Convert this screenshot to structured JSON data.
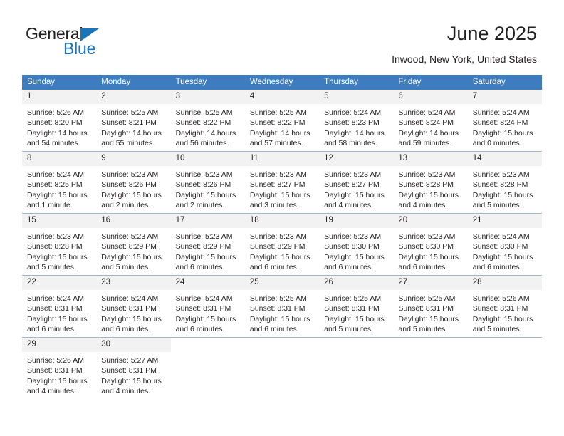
{
  "brand": {
    "line1": "General",
    "line2": "Blue",
    "triangle_color": "#1b75bb",
    "logo_icon": "triangle-icon"
  },
  "header": {
    "month_title": "June 2025",
    "location": "Inwood, New York, United States"
  },
  "theme": {
    "header_blue": "#3d7cbf",
    "daynum_band": "#f2f2f2",
    "week_divider": "#9fb6cd",
    "text": "#231f20"
  },
  "calendar": {
    "weekday_headers": [
      "Sunday",
      "Monday",
      "Tuesday",
      "Wednesday",
      "Thursday",
      "Friday",
      "Saturday"
    ],
    "weeks": [
      [
        {
          "day": "1",
          "sunrise": "Sunrise: 5:26 AM",
          "sunset": "Sunset: 8:20 PM",
          "daylight": "Daylight: 14 hours and 54 minutes."
        },
        {
          "day": "2",
          "sunrise": "Sunrise: 5:25 AM",
          "sunset": "Sunset: 8:21 PM",
          "daylight": "Daylight: 14 hours and 55 minutes."
        },
        {
          "day": "3",
          "sunrise": "Sunrise: 5:25 AM",
          "sunset": "Sunset: 8:22 PM",
          "daylight": "Daylight: 14 hours and 56 minutes."
        },
        {
          "day": "4",
          "sunrise": "Sunrise: 5:25 AM",
          "sunset": "Sunset: 8:22 PM",
          "daylight": "Daylight: 14 hours and 57 minutes."
        },
        {
          "day": "5",
          "sunrise": "Sunrise: 5:24 AM",
          "sunset": "Sunset: 8:23 PM",
          "daylight": "Daylight: 14 hours and 58 minutes."
        },
        {
          "day": "6",
          "sunrise": "Sunrise: 5:24 AM",
          "sunset": "Sunset: 8:24 PM",
          "daylight": "Daylight: 14 hours and 59 minutes."
        },
        {
          "day": "7",
          "sunrise": "Sunrise: 5:24 AM",
          "sunset": "Sunset: 8:24 PM",
          "daylight": "Daylight: 15 hours and 0 minutes."
        }
      ],
      [
        {
          "day": "8",
          "sunrise": "Sunrise: 5:24 AM",
          "sunset": "Sunset: 8:25 PM",
          "daylight": "Daylight: 15 hours and 1 minute."
        },
        {
          "day": "9",
          "sunrise": "Sunrise: 5:23 AM",
          "sunset": "Sunset: 8:26 PM",
          "daylight": "Daylight: 15 hours and 2 minutes."
        },
        {
          "day": "10",
          "sunrise": "Sunrise: 5:23 AM",
          "sunset": "Sunset: 8:26 PM",
          "daylight": "Daylight: 15 hours and 2 minutes."
        },
        {
          "day": "11",
          "sunrise": "Sunrise: 5:23 AM",
          "sunset": "Sunset: 8:27 PM",
          "daylight": "Daylight: 15 hours and 3 minutes."
        },
        {
          "day": "12",
          "sunrise": "Sunrise: 5:23 AM",
          "sunset": "Sunset: 8:27 PM",
          "daylight": "Daylight: 15 hours and 4 minutes."
        },
        {
          "day": "13",
          "sunrise": "Sunrise: 5:23 AM",
          "sunset": "Sunset: 8:28 PM",
          "daylight": "Daylight: 15 hours and 4 minutes."
        },
        {
          "day": "14",
          "sunrise": "Sunrise: 5:23 AM",
          "sunset": "Sunset: 8:28 PM",
          "daylight": "Daylight: 15 hours and 5 minutes."
        }
      ],
      [
        {
          "day": "15",
          "sunrise": "Sunrise: 5:23 AM",
          "sunset": "Sunset: 8:28 PM",
          "daylight": "Daylight: 15 hours and 5 minutes."
        },
        {
          "day": "16",
          "sunrise": "Sunrise: 5:23 AM",
          "sunset": "Sunset: 8:29 PM",
          "daylight": "Daylight: 15 hours and 5 minutes."
        },
        {
          "day": "17",
          "sunrise": "Sunrise: 5:23 AM",
          "sunset": "Sunset: 8:29 PM",
          "daylight": "Daylight: 15 hours and 6 minutes."
        },
        {
          "day": "18",
          "sunrise": "Sunrise: 5:23 AM",
          "sunset": "Sunset: 8:29 PM",
          "daylight": "Daylight: 15 hours and 6 minutes."
        },
        {
          "day": "19",
          "sunrise": "Sunrise: 5:23 AM",
          "sunset": "Sunset: 8:30 PM",
          "daylight": "Daylight: 15 hours and 6 minutes."
        },
        {
          "day": "20",
          "sunrise": "Sunrise: 5:23 AM",
          "sunset": "Sunset: 8:30 PM",
          "daylight": "Daylight: 15 hours and 6 minutes."
        },
        {
          "day": "21",
          "sunrise": "Sunrise: 5:24 AM",
          "sunset": "Sunset: 8:30 PM",
          "daylight": "Daylight: 15 hours and 6 minutes."
        }
      ],
      [
        {
          "day": "22",
          "sunrise": "Sunrise: 5:24 AM",
          "sunset": "Sunset: 8:31 PM",
          "daylight": "Daylight: 15 hours and 6 minutes."
        },
        {
          "day": "23",
          "sunrise": "Sunrise: 5:24 AM",
          "sunset": "Sunset: 8:31 PM",
          "daylight": "Daylight: 15 hours and 6 minutes."
        },
        {
          "day": "24",
          "sunrise": "Sunrise: 5:24 AM",
          "sunset": "Sunset: 8:31 PM",
          "daylight": "Daylight: 15 hours and 6 minutes."
        },
        {
          "day": "25",
          "sunrise": "Sunrise: 5:25 AM",
          "sunset": "Sunset: 8:31 PM",
          "daylight": "Daylight: 15 hours and 6 minutes."
        },
        {
          "day": "26",
          "sunrise": "Sunrise: 5:25 AM",
          "sunset": "Sunset: 8:31 PM",
          "daylight": "Daylight: 15 hours and 5 minutes."
        },
        {
          "day": "27",
          "sunrise": "Sunrise: 5:25 AM",
          "sunset": "Sunset: 8:31 PM",
          "daylight": "Daylight: 15 hours and 5 minutes."
        },
        {
          "day": "28",
          "sunrise": "Sunrise: 5:26 AM",
          "sunset": "Sunset: 8:31 PM",
          "daylight": "Daylight: 15 hours and 5 minutes."
        }
      ],
      [
        {
          "day": "29",
          "sunrise": "Sunrise: 5:26 AM",
          "sunset": "Sunset: 8:31 PM",
          "daylight": "Daylight: 15 hours and 4 minutes."
        },
        {
          "day": "30",
          "sunrise": "Sunrise: 5:27 AM",
          "sunset": "Sunset: 8:31 PM",
          "daylight": "Daylight: 15 hours and 4 minutes."
        },
        {
          "day": "",
          "sunrise": "",
          "sunset": "",
          "daylight": ""
        },
        {
          "day": "",
          "sunrise": "",
          "sunset": "",
          "daylight": ""
        },
        {
          "day": "",
          "sunrise": "",
          "sunset": "",
          "daylight": ""
        },
        {
          "day": "",
          "sunrise": "",
          "sunset": "",
          "daylight": ""
        },
        {
          "day": "",
          "sunrise": "",
          "sunset": "",
          "daylight": ""
        }
      ]
    ]
  }
}
